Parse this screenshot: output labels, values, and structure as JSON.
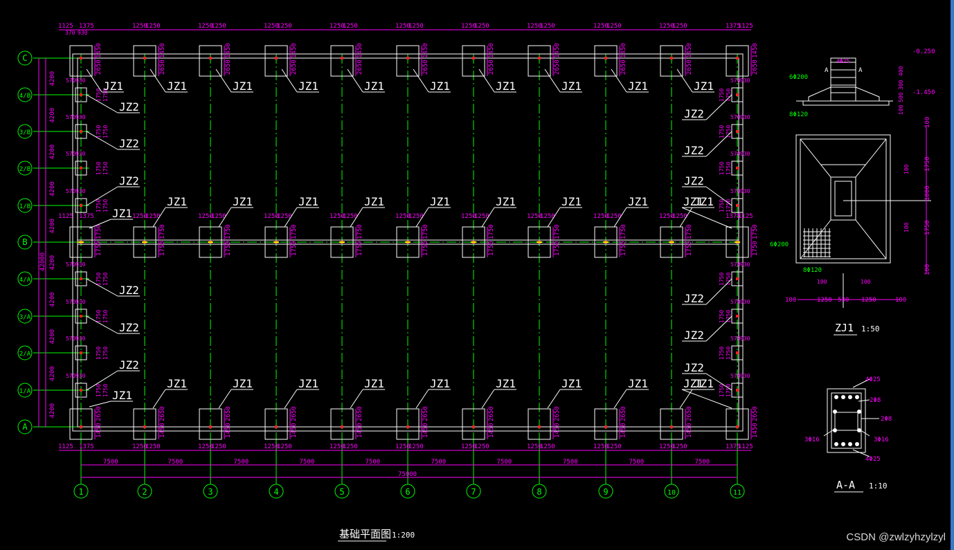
{
  "title": {
    "main": "基础平面图",
    "scale": "1:200"
  },
  "detail_zj1": {
    "title": "ZJ1",
    "scale": "1:50",
    "labels": {
      "top_bar": "4Φ25",
      "elev_top": "-0.250",
      "elev_bot": "-1.450",
      "stirrup1": "6Φ200",
      "stirrup2": "8Φ120",
      "sec": "A",
      "d1": "400",
      "d2": "300",
      "d3": "500",
      "d4": "100"
    },
    "plan_labels": {
      "bar": "6Φ200",
      "bar2": "8Φ120",
      "w1": "100",
      "w2": "1250",
      "w3": "530",
      "w4": "1250",
      "w5": "100",
      "h1": "100",
      "h2": "1750",
      "h3": "1000",
      "h4": "1750",
      "h5": "100",
      "h6": "100"
    }
  },
  "detail_aa": {
    "title": "A-A",
    "scale": "1:10",
    "labels": {
      "top": "4Φ25",
      "bottom": "4Φ25",
      "s1": "2Φ8",
      "s2": "2Φ8",
      "left": "3Φ16",
      "right": "3Φ16"
    }
  },
  "axes": {
    "columns": [
      "1",
      "2",
      "3",
      "4",
      "5",
      "6",
      "7",
      "8",
      "9",
      "10",
      "11"
    ],
    "rows": [
      "C",
      "4/B",
      "3/B",
      "2/B",
      "1/B",
      "B",
      "4/A",
      "3/A",
      "2/A",
      "1/A",
      "A"
    ]
  },
  "dims": {
    "bay": "7500",
    "total": "75000",
    "row": "4200",
    "total_y": "42000",
    "top_left": [
      "1125",
      "1375",
      "370",
      "930"
    ],
    "mid_top": [
      "1250",
      "1250"
    ],
    "top_right": [
      "1375",
      "1125"
    ],
    "side_a": "570",
    "side_b": "930",
    "ftg_v1": "1450",
    "ftg_v2": "2650",
    "ftg_v3": "1750",
    "mid_v": "1750",
    "left_mid": [
      "1125",
      "1375"
    ],
    "right_mid": [
      "1375",
      "1125"
    ]
  },
  "labels": {
    "jz1": "JZ1",
    "jz2": "JZ2"
  },
  "watermark": "CSDN @zwlzyhzylzyl"
}
